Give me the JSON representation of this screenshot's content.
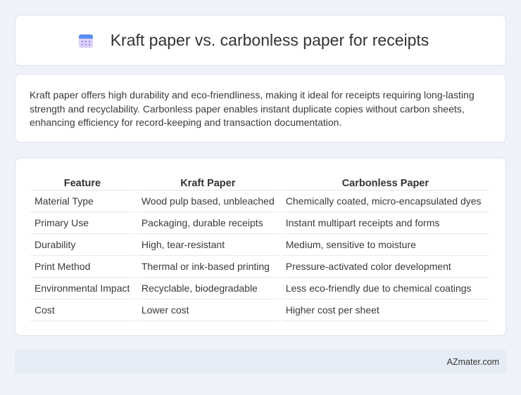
{
  "header": {
    "title": "Kraft paper vs. carbonless paper for receipts",
    "icon": "calendar-icon"
  },
  "summary": {
    "text": "Kraft paper offers high durability and eco-friendliness, making it ideal for receipts requiring long-lasting strength and recyclability. Carbonless paper enables instant duplicate copies without carbon sheets, enhancing efficiency for record-keeping and transaction documentation."
  },
  "table": {
    "headers": [
      "Feature",
      "Kraft Paper",
      "Carbonless Paper"
    ],
    "rows": [
      [
        "Material Type",
        "Wood pulp based, unbleached",
        "Chemically coated, micro-encapsulated dyes"
      ],
      [
        "Primary Use",
        "Packaging, durable receipts",
        "Instant multipart receipts and forms"
      ],
      [
        "Durability",
        "High, tear-resistant",
        "Medium, sensitive to moisture"
      ],
      [
        "Print Method",
        "Thermal or ink-based printing",
        "Pressure-activated color development"
      ],
      [
        "Environmental Impact",
        "Recyclable, biodegradable",
        "Less eco-friendly due to chemical coatings"
      ],
      [
        "Cost",
        "Lower cost",
        "Higher cost per sheet"
      ]
    ]
  },
  "footer": {
    "brand": "AZmater.com"
  },
  "colors": {
    "background": "#eff3f9",
    "card": "#ffffff",
    "footer": "#e6ecf5",
    "icon_top": "#5b8def",
    "icon_body": "#c9b8f3"
  }
}
